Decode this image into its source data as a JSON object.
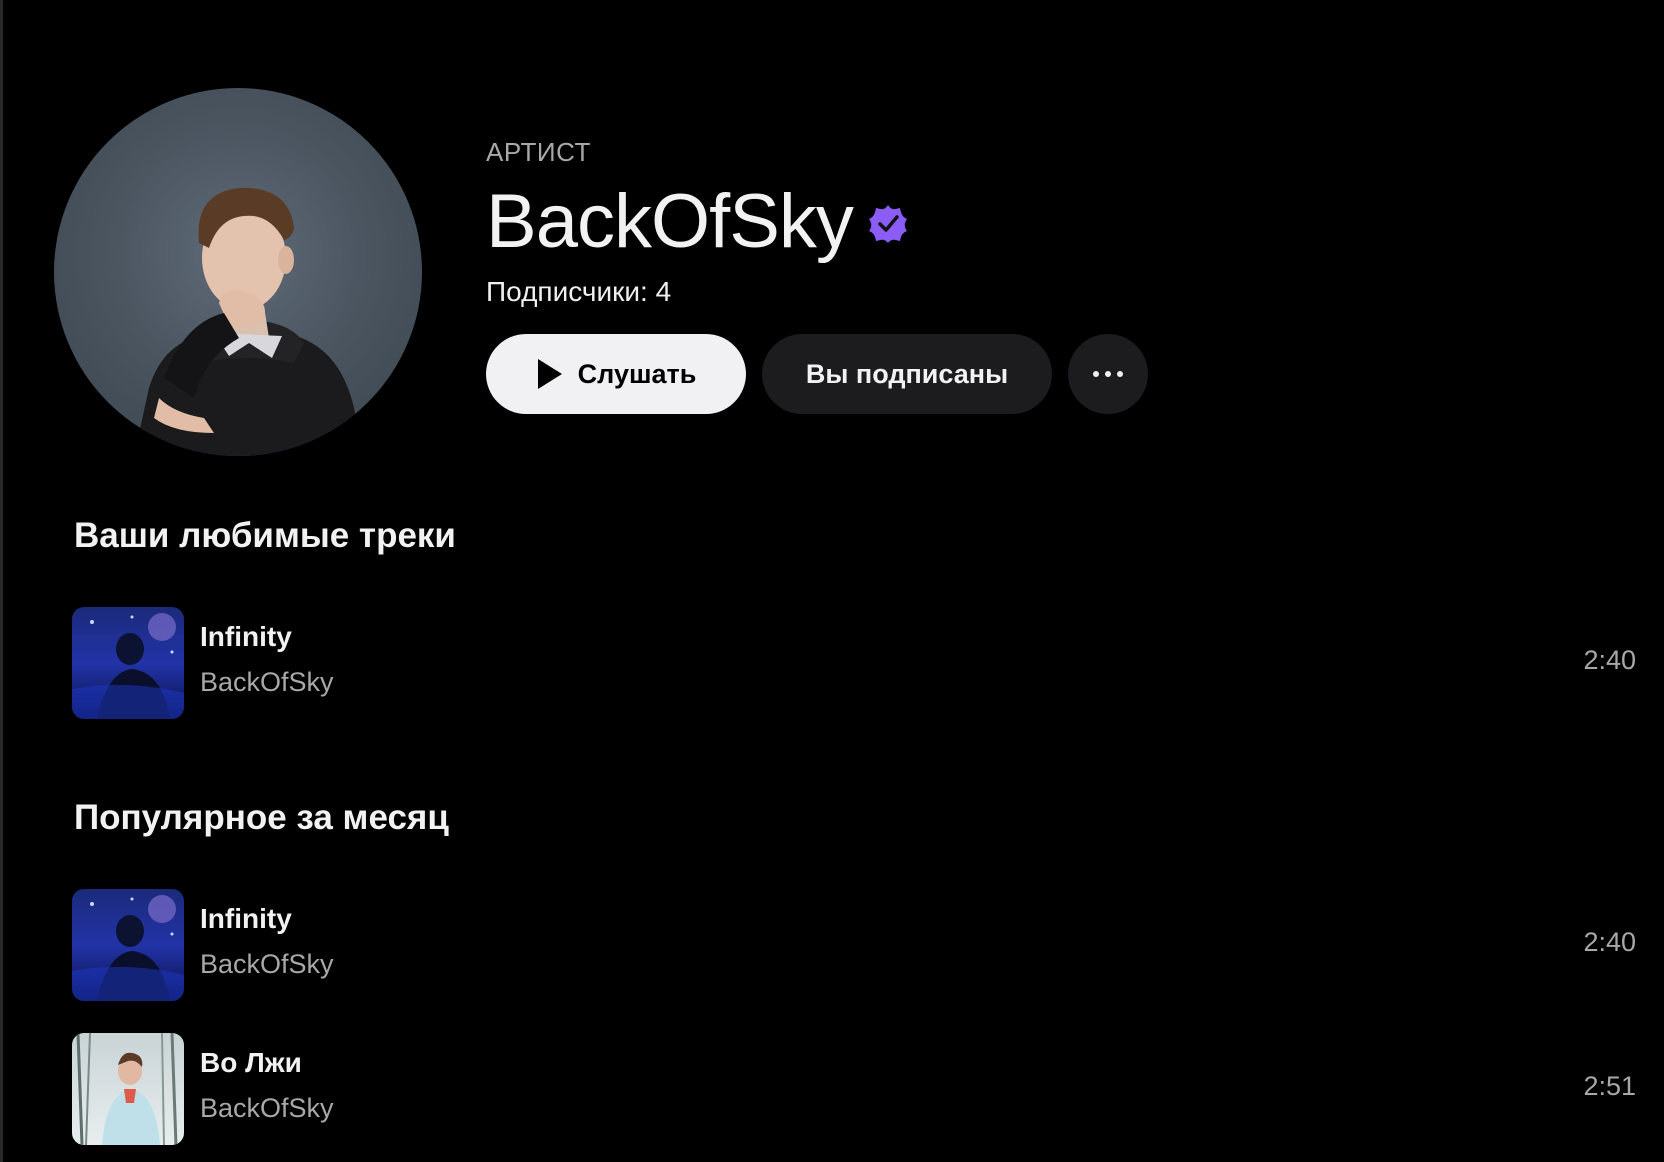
{
  "artist": {
    "type_label": "АРТИСТ",
    "name": "BackOfSky",
    "followers": "Подписчики: 4",
    "avatar_icon": "artist-photo",
    "verified_icon": "verified-badge-icon",
    "accent_color": "#8b5cf6"
  },
  "actions": {
    "listen_label": "Слушать",
    "follow_label": "Вы подписаны",
    "more_icon": "more-horizontal-icon"
  },
  "favorites": {
    "title": "Ваши любимые треки",
    "tracks": [
      {
        "title": "Infinity",
        "artist": "BackOfSky",
        "duration": "2:40"
      }
    ]
  },
  "popular": {
    "title": "Популярное за месяц",
    "tracks": [
      {
        "title": "Infinity",
        "artist": "BackOfSky",
        "duration": "2:40"
      },
      {
        "title": "Во Лжи",
        "artist": "BackOfSky",
        "duration": "2:51"
      }
    ]
  }
}
